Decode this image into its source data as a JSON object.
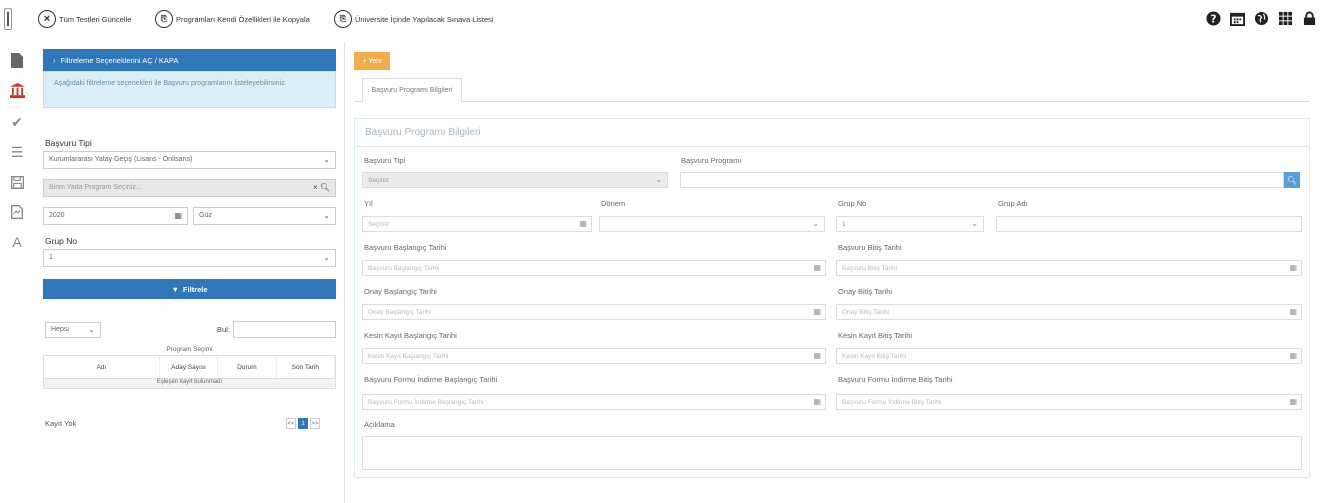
{
  "toolbar": {
    "btn1_label": "Tüm Testleri Güncelle",
    "btn2_label": "Programları Kendi Özellikleri ile Kopyala",
    "btn3_label": "Üniversite İçinde Yapılacak Sınava Listesi"
  },
  "filter": {
    "header": "Filtreleme Seçeneklerini AÇ / KAPA",
    "info": "Aşağıdaki filtreleme seçenekleri ile Başvuru programlarını listeleyebilirsiniz.",
    "basvuru_tipi_label": "Başvuru Tipi",
    "basvuru_tipi_value": "Kurumlararası Yatay Geçiş (Lisans - Önlisans)",
    "program_placeholder": "Birim Yada Program Seçiniz...",
    "yil_value": "2020",
    "donem_value": "Güz",
    "grup_no_label": "Grup No",
    "grup_no_value": "1",
    "filter_button": "Filtrele"
  },
  "list": {
    "page_size": "Hepsi",
    "search_label": "Bul:",
    "column_group": "Program Seçimi",
    "columns": [
      "Adı",
      "Aday Sayısı",
      "Durum",
      "Son Tarih"
    ],
    "empty_text": "Eşleşen kayıt bulunmadı",
    "record_text": "Kayıt Yok",
    "pager": [
      "<<",
      "1",
      ">>"
    ]
  },
  "main": {
    "new_button": "+ Yeni",
    "tab_label": "Başvuru Programı Bilgileri",
    "panel_title": "Başvuru Programı Bilgileri",
    "basvuru_tipi_label": "Başvuru Tipi",
    "basvuru_tipi_value": "Seçiniz",
    "basvuru_program_label": "Başvuru Programı",
    "yil_label": "Yıl",
    "yil_placeholder": "Seçiniz",
    "donem_label": "Dönem",
    "grup_no_label": "Grup No",
    "grup_no_value": "1",
    "grup_adi_label": "Grup Adı",
    "bas_baslangic_label": "Başvuru Başlangıç Tarihi",
    "bas_baslangic_ph": "Başvuru Başlangıç Tarihi",
    "bas_bitis_label": "Başvuru Bitiş Tarihi",
    "bas_bitis_ph": "Başvuru Bitiş Tarihi",
    "onay_baslangic_label": "Onay Başlangıç Tarihi",
    "onay_baslangic_ph": "Onay Başlangıç Tarihi",
    "onay_bitis_label": "Onay Bitiş Tarihi",
    "onay_bitis_ph": "Onay Bitiş Tarihi",
    "kesin_baslangic_label": "Kesin Kayıt Başlangıç Tarihi",
    "kesin_baslangic_ph": "Kesin Kayıt Başlangıç Tarihi",
    "kesin_bitis_label": "Kesin Kayıt Bitiş Tarihi",
    "kesin_bitis_ph": "Kesin Kayıt Bitiş Tarihi",
    "form_baslangic_label": "Başvuru Formu İndirme Başlangıç Tarihi",
    "form_baslangic_ph": "Başvuru Formu İndirme Başlangıç Tarihi",
    "form_bitis_label": "Başvuru Formu İndirme Bitiş Tarihi",
    "form_bitis_ph": "Başvuru Formu İndirme Bitiş Tarihi",
    "aciklama_label": "Açıklama"
  }
}
